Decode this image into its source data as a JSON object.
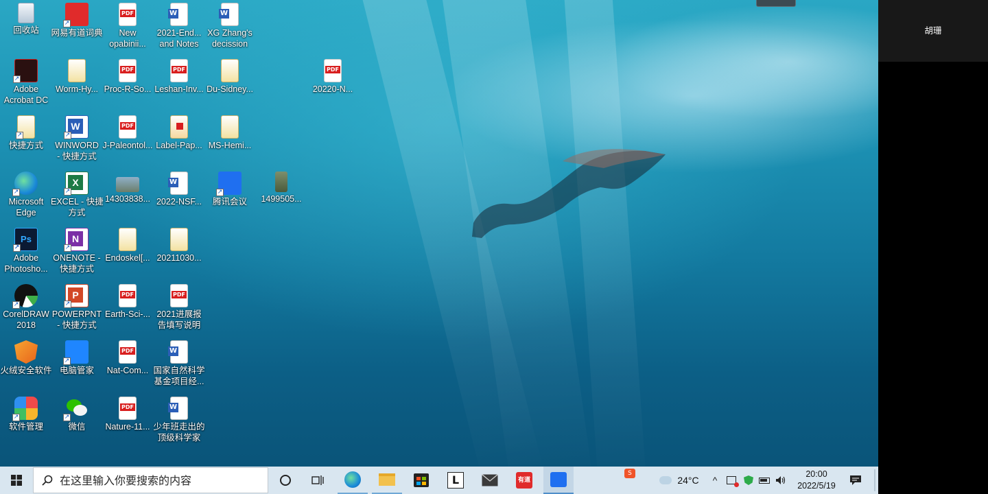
{
  "desktop": {
    "icons": [
      {
        "id": "recycle",
        "label1": "回收站",
        "label2": ""
      },
      {
        "id": "youdao",
        "label1": "网易有道词典",
        "label2": ""
      },
      {
        "id": "pdf-new",
        "label1": "New",
        "label2": "opabinii..."
      },
      {
        "id": "doc-2021",
        "label1": "2021-End...",
        "label2": "and Notes"
      },
      {
        "id": "doc-xg",
        "label1": "XG Zhang's",
        "label2": "decission"
      },
      {
        "id": "acrobat",
        "label1": "Adobe",
        "label2": "Acrobat DC"
      },
      {
        "id": "worm",
        "label1": "Worm-Hy...",
        "label2": ""
      },
      {
        "id": "proc",
        "label1": "Proc-R-So...",
        "label2": ""
      },
      {
        "id": "leshan",
        "label1": "Leshan-Inv...",
        "label2": ""
      },
      {
        "id": "du",
        "label1": "Du-Sidney...",
        "label2": ""
      },
      {
        "id": "pdf-20220",
        "label1": "20220-N...",
        "label2": ""
      },
      {
        "id": "kuaijie",
        "label1": "快捷方式",
        "label2": ""
      },
      {
        "id": "winword",
        "label1": "WINWORD",
        "label2": "- 快捷方式"
      },
      {
        "id": "jpaleo",
        "label1": "J-Paleontol...",
        "label2": ""
      },
      {
        "id": "labelpap",
        "label1": "Label-Pap...",
        "label2": ""
      },
      {
        "id": "mshemi",
        "label1": "MS-Hemi...",
        "label2": ""
      },
      {
        "id": "edge",
        "label1": "Microsoft",
        "label2": "Edge"
      },
      {
        "id": "excel",
        "label1": "EXCEL - 快捷",
        "label2": "方式"
      },
      {
        "id": "img1430",
        "label1": "14303838...",
        "label2": ""
      },
      {
        "id": "nsf",
        "label1": "2022-NSF...",
        "label2": ""
      },
      {
        "id": "tencent-meeting",
        "label1": "腾讯会议",
        "label2": ""
      },
      {
        "id": "img1499",
        "label1": "1499505...",
        "label2": ""
      },
      {
        "id": "photoshop",
        "label1": "Adobe",
        "label2": "Photosho..."
      },
      {
        "id": "onenote",
        "label1": "ONENOTE -",
        "label2": "快捷方式"
      },
      {
        "id": "endoskel",
        "label1": "Endoskel[...",
        "label2": ""
      },
      {
        "id": "f2021103",
        "label1": "20211030...",
        "label2": ""
      },
      {
        "id": "coreldraw",
        "label1": "CorelDRAW",
        "label2": "2018"
      },
      {
        "id": "powerpnt",
        "label1": "POWERPNT",
        "label2": "- 快捷方式"
      },
      {
        "id": "earthsci",
        "label1": "Earth-Sci-...",
        "label2": ""
      },
      {
        "id": "progress2021",
        "label1": "2021进展报",
        "label2": "告填写说明"
      },
      {
        "id": "huorong",
        "label1": "火绒安全软件",
        "label2": ""
      },
      {
        "id": "pcmanager",
        "label1": "电脑管家",
        "label2": ""
      },
      {
        "id": "natcom",
        "label1": "Nat-Com...",
        "label2": ""
      },
      {
        "id": "nsfc",
        "label1": "国家自然科学",
        "label2": "基金项目经..."
      },
      {
        "id": "softmgr",
        "label1": "软件管理",
        "label2": ""
      },
      {
        "id": "wechat",
        "label1": "微信",
        "label2": ""
      },
      {
        "id": "nature11",
        "label1": "Nature-11...",
        "label2": ""
      },
      {
        "id": "youth",
        "label1": "少年班走出的",
        "label2": "顶级科学家"
      }
    ]
  },
  "taskbar": {
    "search_placeholder": "在这里输入你要搜索的内容",
    "weather_temp": "24°C",
    "time": "20:00",
    "date": "2022/5/19",
    "youdao_label": "有道"
  },
  "side_panel": {
    "participant_name": "胡珊"
  }
}
